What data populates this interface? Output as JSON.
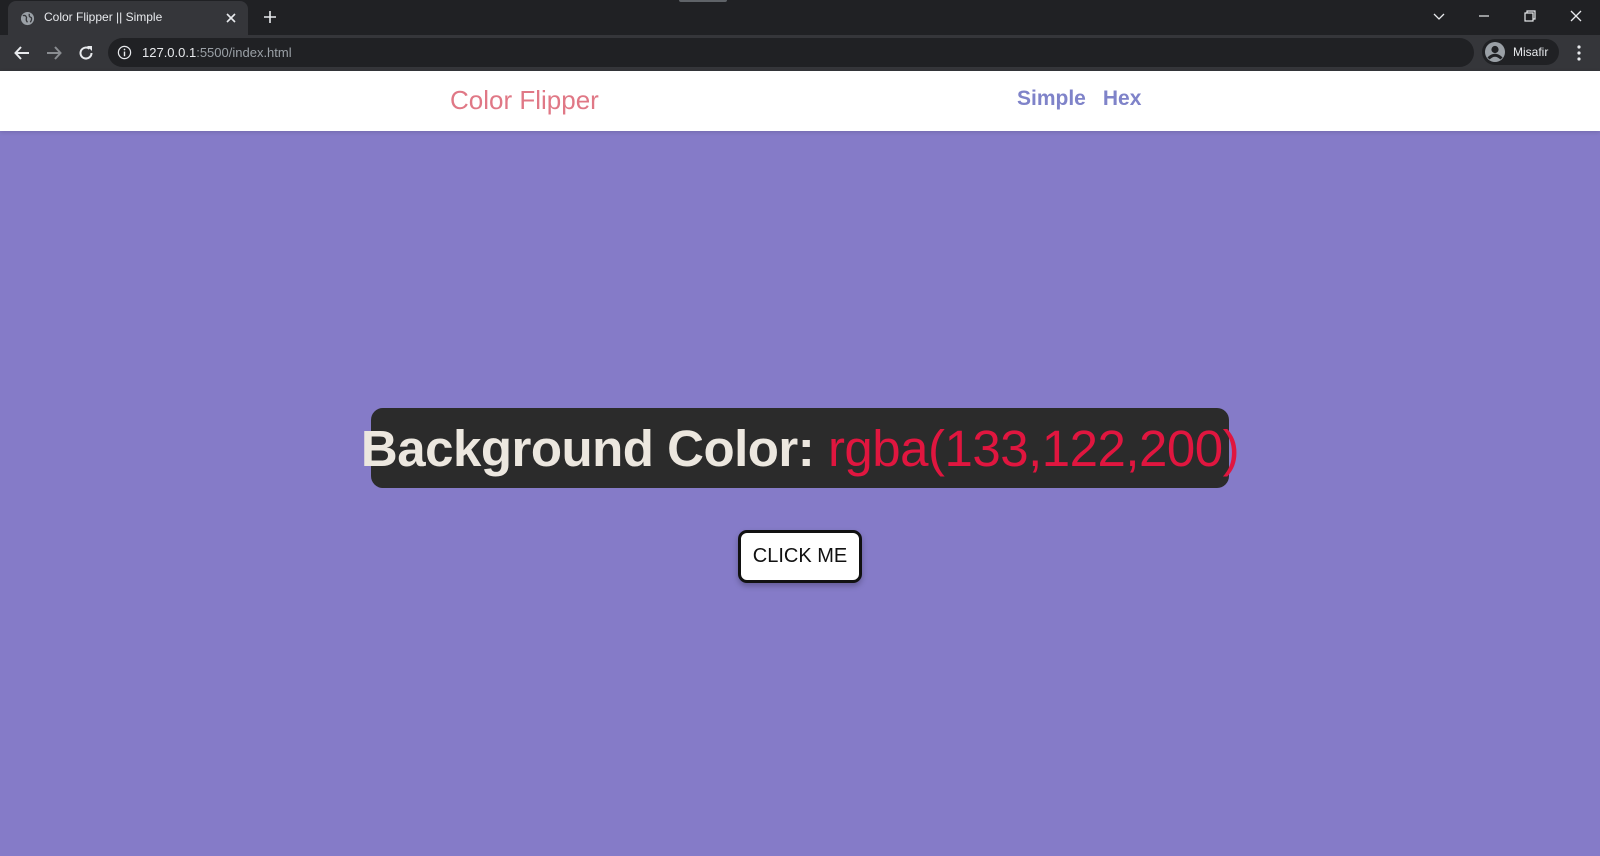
{
  "browser": {
    "tab": {
      "title": "Color Flipper || Simple"
    },
    "url_host": "127.0.0.1",
    "url_rest": ":5500/index.html",
    "profile_name": "Misafir"
  },
  "navbar": {
    "brand": "Color Flipper",
    "links": [
      {
        "label": "Simple"
      },
      {
        "label": "Hex"
      }
    ]
  },
  "main": {
    "heading_label": "Background Color:",
    "color_value": "rgba(133,122,200)",
    "button_label": "CLICK ME"
  },
  "colors": {
    "page_background": "#857bc8",
    "brand": "#e07886",
    "nav_link": "#7f83c9",
    "color_value": "#e0163f",
    "color_box_bg": "#2b2b2b"
  },
  "icons": [
    "globe-icon",
    "close-icon",
    "plus-icon",
    "chevron-down-icon",
    "minimize-icon",
    "restore-icon",
    "back-arrow-icon",
    "forward-arrow-icon",
    "reload-icon",
    "info-icon",
    "avatar-icon",
    "kebab-menu-icon"
  ]
}
